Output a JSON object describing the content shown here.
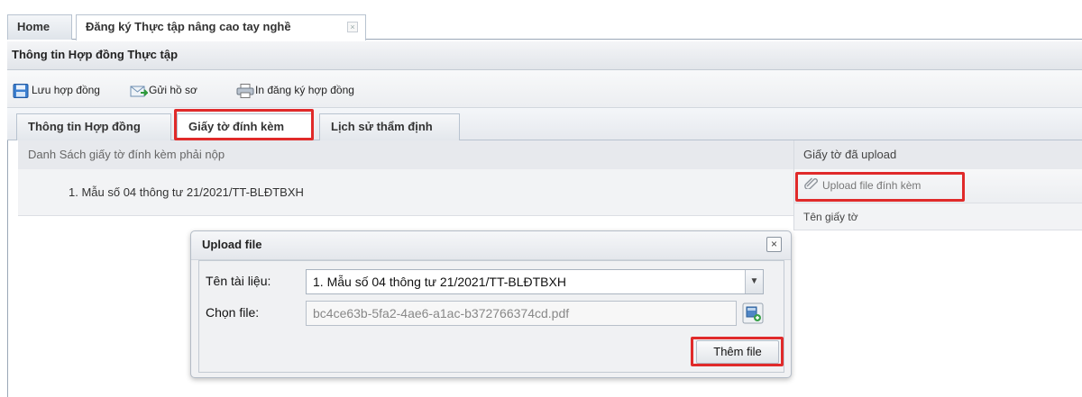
{
  "top_tabs": [
    {
      "label": "Home"
    },
    {
      "label": "Đăng ký Thực tập nâng cao tay nghề"
    }
  ],
  "panel": {
    "title": "Thông tin Hợp đồng Thực tập"
  },
  "toolbar": {
    "save_label": "Lưu hợp đồng",
    "send_label": "Gửi hồ sơ",
    "print_label": "In đăng ký hợp đồng"
  },
  "inner_tabs": [
    {
      "label": "Thông tin Hợp đồng"
    },
    {
      "label": "Giấy tờ đính kèm"
    },
    {
      "label": "Lịch sử thẩm định"
    }
  ],
  "left_list": {
    "header": "Danh Sách giấy tờ đính kèm phải nộp",
    "items": [
      "1. Mẫu số 04 thông tư 21/2021/TT-BLĐTBXH"
    ]
  },
  "right_panel": {
    "header": "Giấy tờ đã upload",
    "upload_label": "Upload file đính kèm",
    "column_header": "Tên giấy tờ"
  },
  "modal": {
    "title": "Upload file",
    "doc_label": "Tên tài liệu:",
    "doc_value": "1. Mẫu số 04 thông tư 21/2021/TT-BLĐTBXH",
    "file_label": "Chọn file:",
    "file_value": "bc4ce63b-5fa2-4ae6-a1ac-b372766374cd.pdf",
    "add_button": "Thêm file",
    "close_glyph": "×"
  },
  "icons": {
    "close": "×",
    "dropdown": "▼"
  },
  "colors": {
    "highlight": "#e02a2a",
    "border": "#9aa7b7"
  }
}
